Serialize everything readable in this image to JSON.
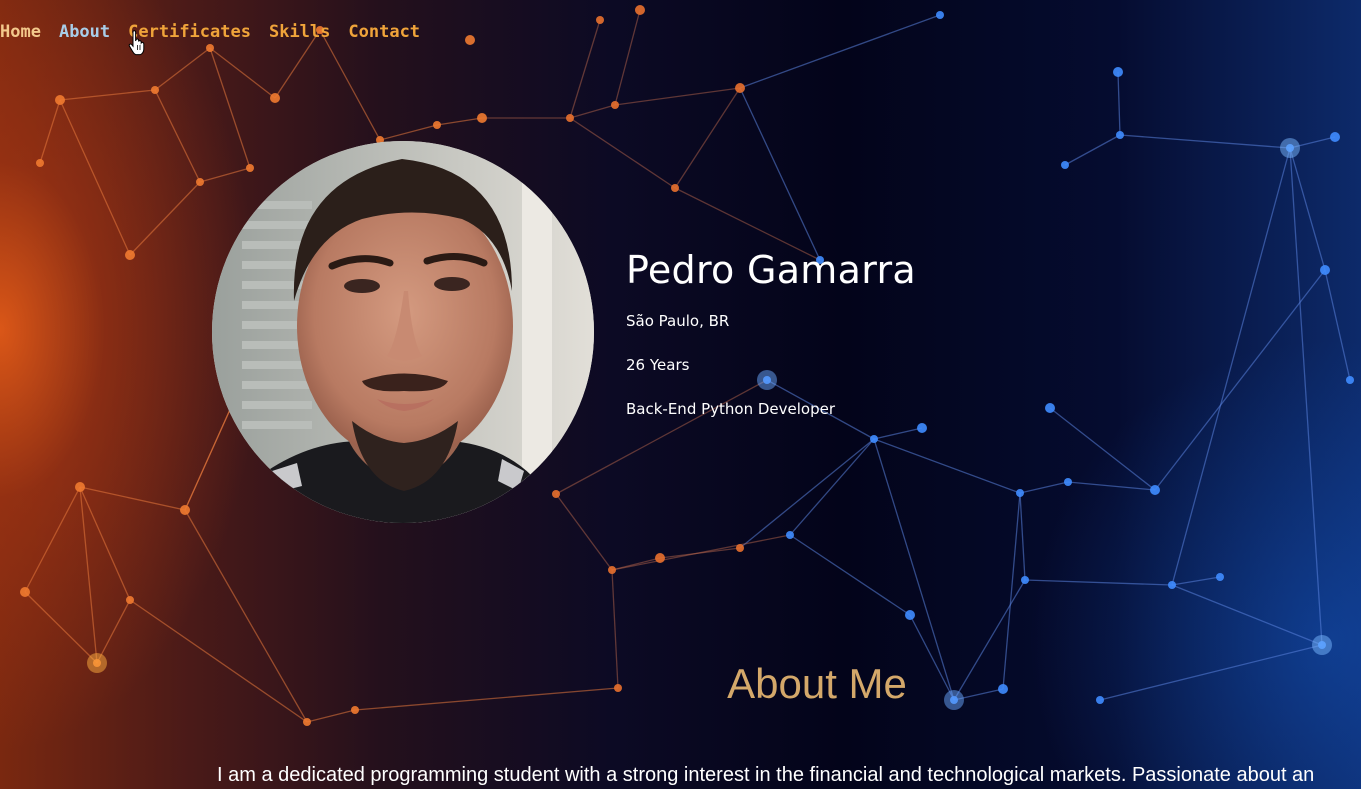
{
  "nav": {
    "items": [
      "Home",
      "About",
      "Certificates",
      "Skills",
      "Contact"
    ],
    "active": "About"
  },
  "profile": {
    "name": "Pedro Gamarra",
    "location": "São Paulo, BR",
    "age": "26 Years",
    "role": "Back-End Python Developer"
  },
  "about": {
    "title": "About Me",
    "text": "I am a dedicated programming student with a strong interest in the financial and technological markets. Passionate about an"
  },
  "colors": {
    "nav_link": "#f0a43a",
    "nav_active": "#a8cde8",
    "about_title": "#d4a86a",
    "text": "#ffffff"
  },
  "icons": [
    "hand-pointer-cursor-icon"
  ]
}
